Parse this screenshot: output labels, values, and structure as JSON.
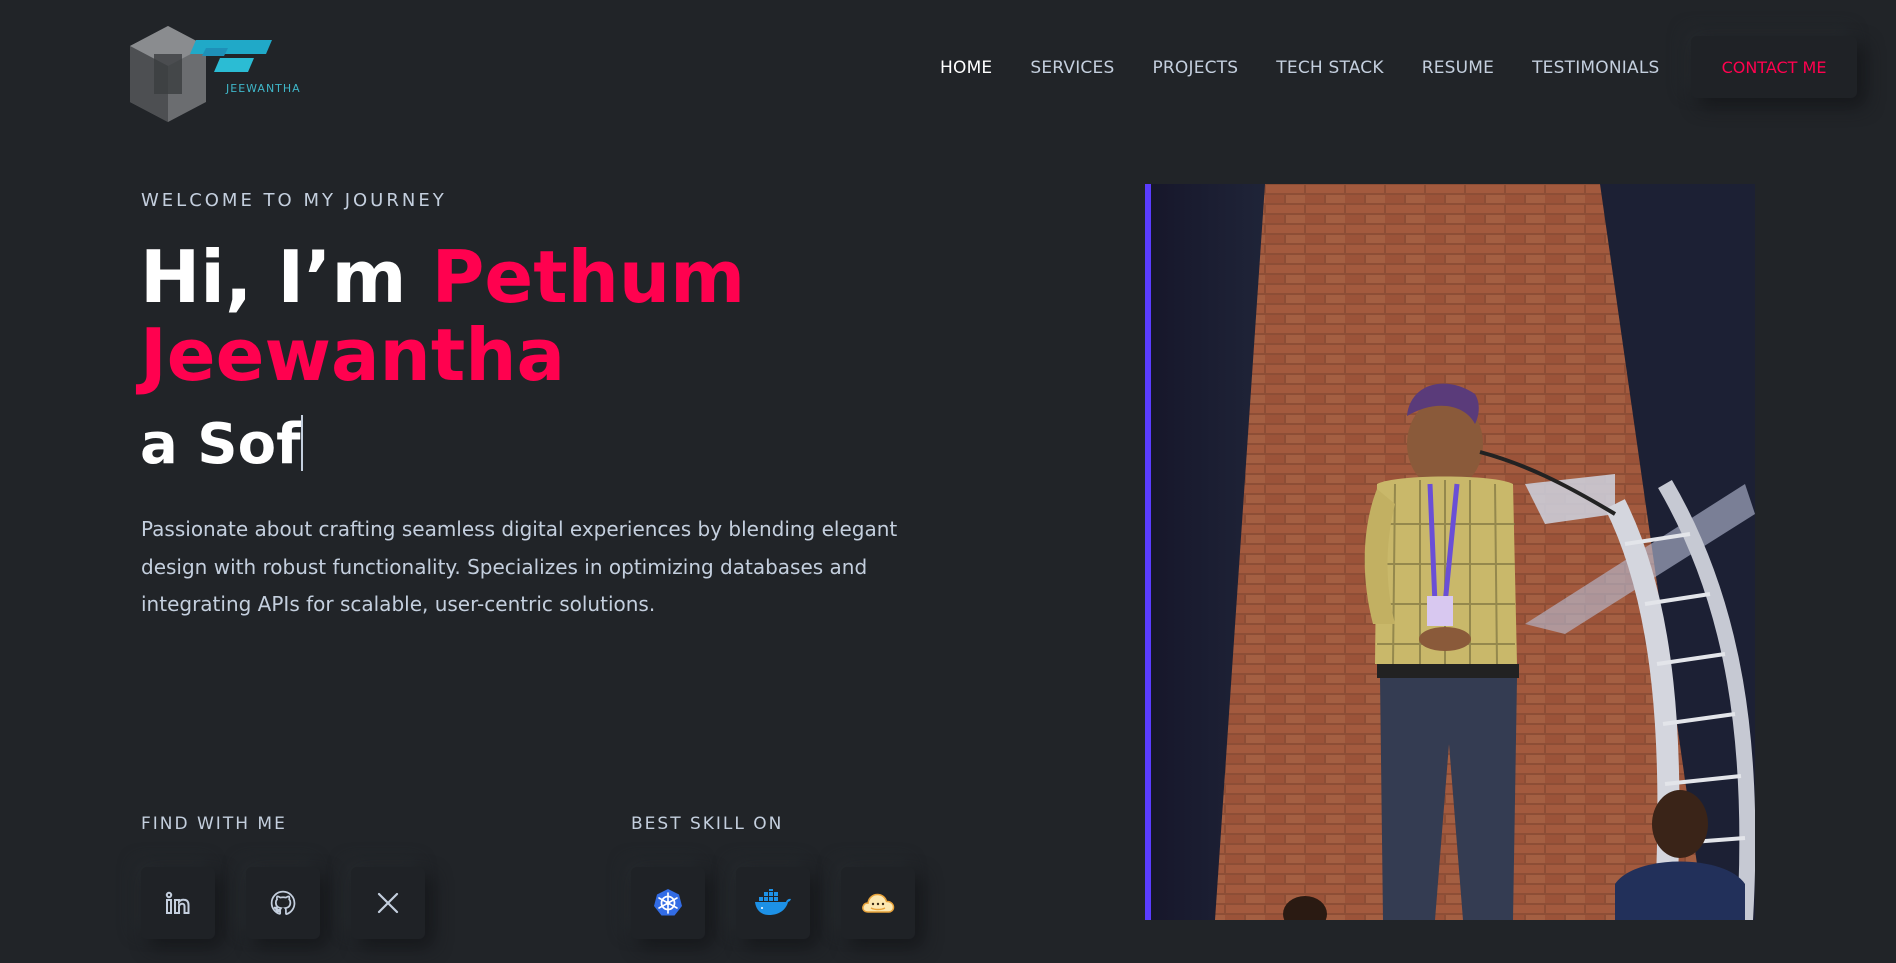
{
  "header": {
    "logo_text": "JEEWANTHA",
    "nav": [
      {
        "label": "HOME",
        "active": true
      },
      {
        "label": "SERVICES"
      },
      {
        "label": "PROJECTS"
      },
      {
        "label": "TECH STACK"
      },
      {
        "label": "RESUME"
      },
      {
        "label": "TESTIMONIALS"
      }
    ],
    "contact_label": "CONTACT ME"
  },
  "hero": {
    "eyebrow": "WELCOME TO MY JOURNEY",
    "greeting": "Hi, I’m",
    "name_first": "Pethum",
    "name_last": "Jeewantha",
    "typed": "a Sof",
    "bio": "Passionate about crafting seamless digital experiences by blending elegant design with robust functionality. Specializes in optimizing databases and integrating APIs for scalable, user-centric solutions."
  },
  "social": {
    "label": "FIND WITH ME",
    "icons": [
      "linkedin-icon",
      "github-icon",
      "x-icon"
    ]
  },
  "skills": {
    "label": "BEST SKILL ON",
    "icons": [
      "kubernetes-icon",
      "docker-icon",
      "aws-icon"
    ]
  },
  "colors": {
    "background": "#212428",
    "accent": "#ff014f",
    "text": "#c4cfde"
  }
}
